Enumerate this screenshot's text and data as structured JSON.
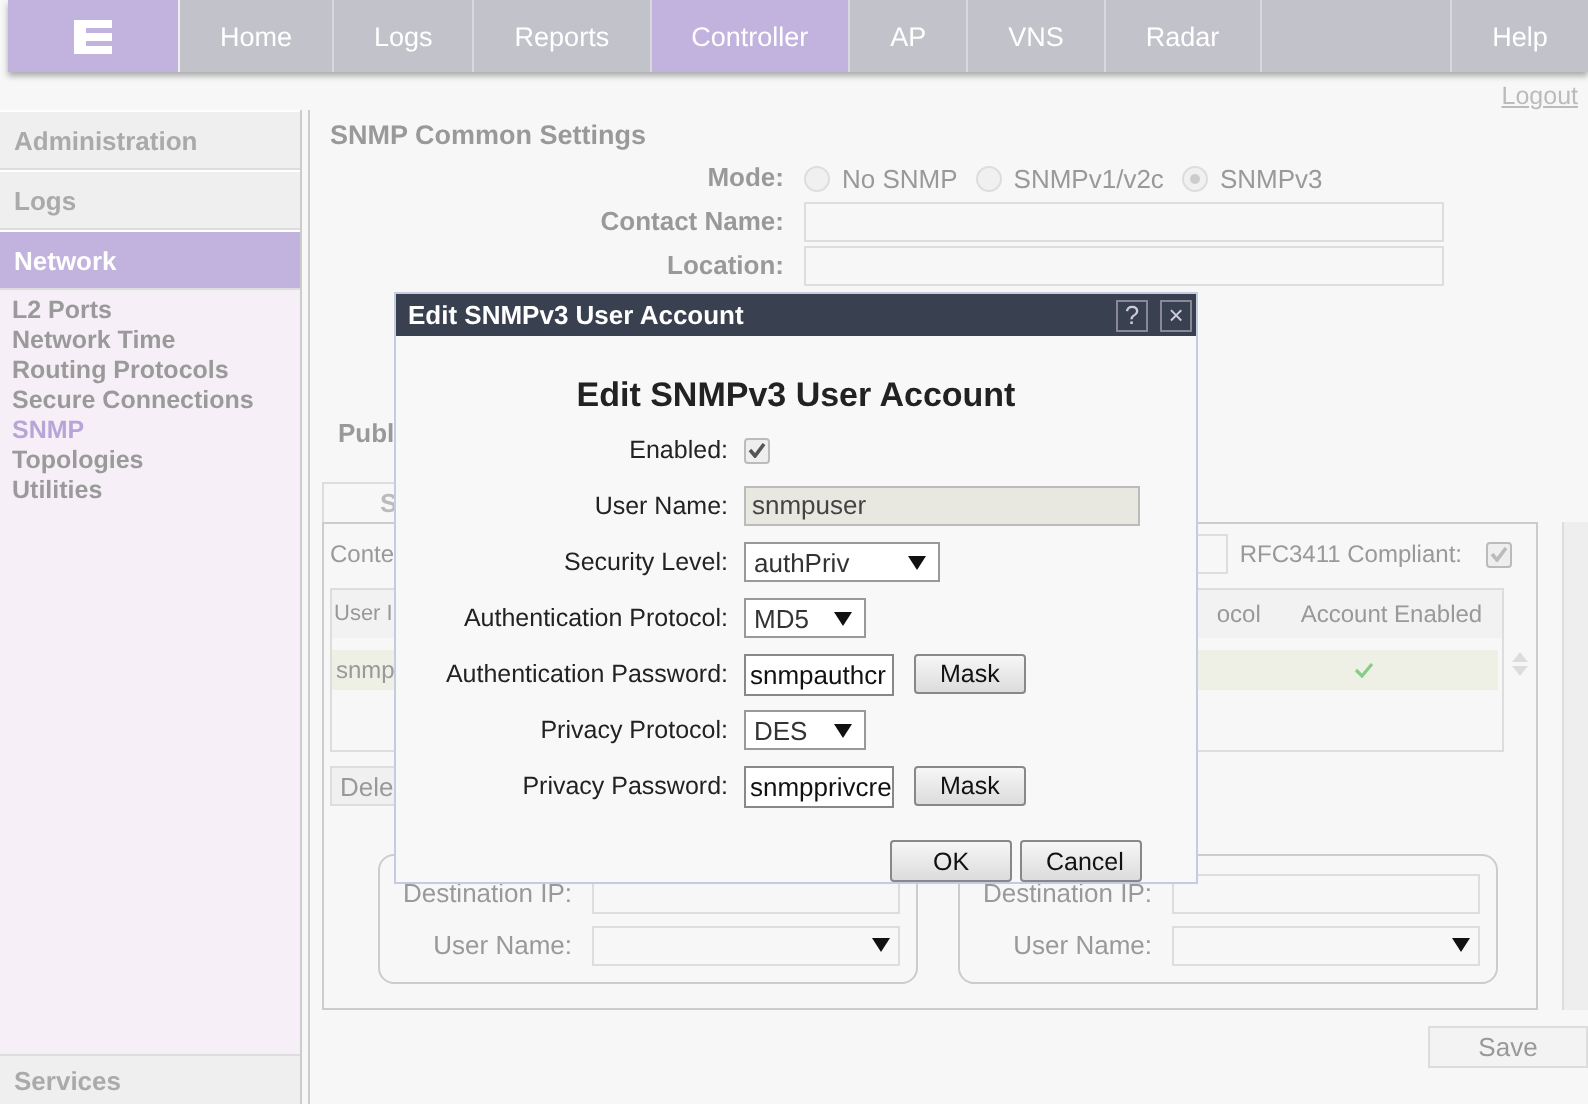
{
  "nav": {
    "tabs": [
      {
        "label": "Home",
        "selected": false
      },
      {
        "label": "Logs",
        "selected": false
      },
      {
        "label": "Reports",
        "selected": false
      },
      {
        "label": "Controller",
        "selected": true
      },
      {
        "label": "AP",
        "selected": false
      },
      {
        "label": "VNS",
        "selected": false
      },
      {
        "label": "Radar",
        "selected": false
      }
    ],
    "help": "Help",
    "logout": "Logout"
  },
  "sidebar": {
    "sections": [
      {
        "label": "Administration",
        "selected": false
      },
      {
        "label": "Logs",
        "selected": false
      },
      {
        "label": "Network",
        "selected": true,
        "items": [
          {
            "label": "L2 Ports",
            "selected": false
          },
          {
            "label": "Network Time",
            "selected": false
          },
          {
            "label": "Routing Protocols",
            "selected": false
          },
          {
            "label": "Secure Connections",
            "selected": false
          },
          {
            "label": "SNMP",
            "selected": true
          },
          {
            "label": "Topologies",
            "selected": false
          },
          {
            "label": "Utilities",
            "selected": false
          }
        ]
      }
    ],
    "footer": "Services"
  },
  "common": {
    "title": "SNMP Common Settings",
    "mode_label": "Mode:",
    "modes": [
      {
        "label": "No SNMP",
        "selected": false
      },
      {
        "label": "SNMPv1/v2c",
        "selected": false
      },
      {
        "label": "SNMPv3",
        "selected": true
      }
    ],
    "contact_label": "Contact Name:",
    "location_label": "Location:"
  },
  "public_label": "Publ",
  "tab": "S",
  "panel": {
    "context_label": "Conte",
    "rfc_label": "RFC3411 Compliant:",
    "rfc_checked": true,
    "columns": [
      "User I",
      "ocol",
      "Account Enabled"
    ],
    "rows": [
      {
        "user": "snmp",
        "enabled": true,
        "selected": true
      }
    ],
    "delete_button": "Dele",
    "destinations": [
      {
        "ip_label": "Destination IP:",
        "user_label": "User Name:"
      },
      {
        "ip_label": "Destination IP:",
        "user_label": "User Name:"
      }
    ]
  },
  "save": "Save",
  "dialog": {
    "title": "Edit SNMPv3 User Account",
    "help": "?",
    "close": "×",
    "heading": "Edit SNMPv3 User Account",
    "rows": [
      {
        "kind": "checkbox",
        "label": "Enabled:",
        "checked": true
      },
      {
        "kind": "text",
        "label": "User Name:",
        "value": "snmpuser"
      },
      {
        "kind": "select",
        "label": "Security Level:",
        "value": "authPriv"
      },
      {
        "kind": "select",
        "label": "Authentication Protocol:",
        "value": "MD5"
      },
      {
        "kind": "secret",
        "label": "Authentication Password:",
        "value": "snmpauthcr",
        "button": "Mask"
      },
      {
        "kind": "select",
        "label": "Privacy Protocol:",
        "value": "DES"
      },
      {
        "kind": "secret",
        "label": "Privacy Password:",
        "value": "snmpprivcre",
        "button": "Mask"
      }
    ],
    "ok": "OK",
    "cancel": "Cancel"
  }
}
